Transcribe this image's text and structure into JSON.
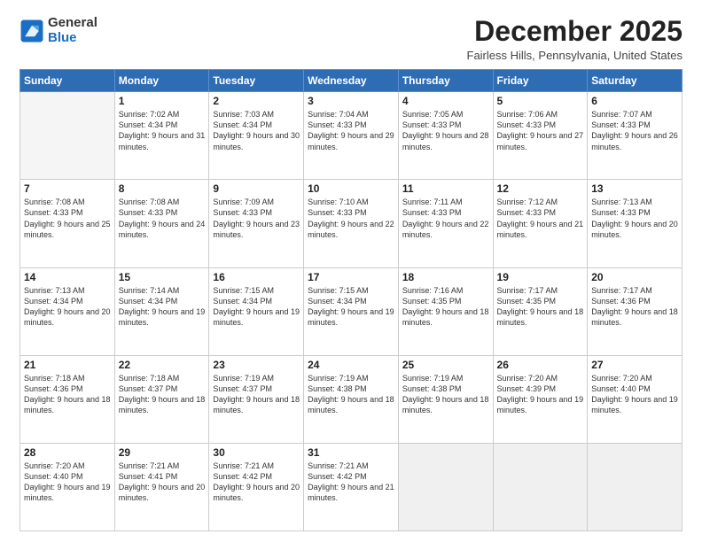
{
  "logo": {
    "general": "General",
    "blue": "Blue"
  },
  "title": "December 2025",
  "location": "Fairless Hills, Pennsylvania, United States",
  "days_of_week": [
    "Sunday",
    "Monday",
    "Tuesday",
    "Wednesday",
    "Thursday",
    "Friday",
    "Saturday"
  ],
  "weeks": [
    [
      {
        "day": "",
        "empty": true
      },
      {
        "day": "1",
        "sunrise": "7:02 AM",
        "sunset": "4:34 PM",
        "daylight": "9 hours and 31 minutes."
      },
      {
        "day": "2",
        "sunrise": "7:03 AM",
        "sunset": "4:34 PM",
        "daylight": "9 hours and 30 minutes."
      },
      {
        "day": "3",
        "sunrise": "7:04 AM",
        "sunset": "4:33 PM",
        "daylight": "9 hours and 29 minutes."
      },
      {
        "day": "4",
        "sunrise": "7:05 AM",
        "sunset": "4:33 PM",
        "daylight": "9 hours and 28 minutes."
      },
      {
        "day": "5",
        "sunrise": "7:06 AM",
        "sunset": "4:33 PM",
        "daylight": "9 hours and 27 minutes."
      },
      {
        "day": "6",
        "sunrise": "7:07 AM",
        "sunset": "4:33 PM",
        "daylight": "9 hours and 26 minutes."
      }
    ],
    [
      {
        "day": "7",
        "sunrise": "7:08 AM",
        "sunset": "4:33 PM",
        "daylight": "9 hours and 25 minutes."
      },
      {
        "day": "8",
        "sunrise": "7:08 AM",
        "sunset": "4:33 PM",
        "daylight": "9 hours and 24 minutes."
      },
      {
        "day": "9",
        "sunrise": "7:09 AM",
        "sunset": "4:33 PM",
        "daylight": "9 hours and 23 minutes."
      },
      {
        "day": "10",
        "sunrise": "7:10 AM",
        "sunset": "4:33 PM",
        "daylight": "9 hours and 22 minutes."
      },
      {
        "day": "11",
        "sunrise": "7:11 AM",
        "sunset": "4:33 PM",
        "daylight": "9 hours and 22 minutes."
      },
      {
        "day": "12",
        "sunrise": "7:12 AM",
        "sunset": "4:33 PM",
        "daylight": "9 hours and 21 minutes."
      },
      {
        "day": "13",
        "sunrise": "7:13 AM",
        "sunset": "4:33 PM",
        "daylight": "9 hours and 20 minutes."
      }
    ],
    [
      {
        "day": "14",
        "sunrise": "7:13 AM",
        "sunset": "4:34 PM",
        "daylight": "9 hours and 20 minutes."
      },
      {
        "day": "15",
        "sunrise": "7:14 AM",
        "sunset": "4:34 PM",
        "daylight": "9 hours and 19 minutes."
      },
      {
        "day": "16",
        "sunrise": "7:15 AM",
        "sunset": "4:34 PM",
        "daylight": "9 hours and 19 minutes."
      },
      {
        "day": "17",
        "sunrise": "7:15 AM",
        "sunset": "4:34 PM",
        "daylight": "9 hours and 19 minutes."
      },
      {
        "day": "18",
        "sunrise": "7:16 AM",
        "sunset": "4:35 PM",
        "daylight": "9 hours and 18 minutes."
      },
      {
        "day": "19",
        "sunrise": "7:17 AM",
        "sunset": "4:35 PM",
        "daylight": "9 hours and 18 minutes."
      },
      {
        "day": "20",
        "sunrise": "7:17 AM",
        "sunset": "4:36 PM",
        "daylight": "9 hours and 18 minutes."
      }
    ],
    [
      {
        "day": "21",
        "sunrise": "7:18 AM",
        "sunset": "4:36 PM",
        "daylight": "9 hours and 18 minutes."
      },
      {
        "day": "22",
        "sunrise": "7:18 AM",
        "sunset": "4:37 PM",
        "daylight": "9 hours and 18 minutes."
      },
      {
        "day": "23",
        "sunrise": "7:19 AM",
        "sunset": "4:37 PM",
        "daylight": "9 hours and 18 minutes."
      },
      {
        "day": "24",
        "sunrise": "7:19 AM",
        "sunset": "4:38 PM",
        "daylight": "9 hours and 18 minutes."
      },
      {
        "day": "25",
        "sunrise": "7:19 AM",
        "sunset": "4:38 PM",
        "daylight": "9 hours and 18 minutes."
      },
      {
        "day": "26",
        "sunrise": "7:20 AM",
        "sunset": "4:39 PM",
        "daylight": "9 hours and 19 minutes."
      },
      {
        "day": "27",
        "sunrise": "7:20 AM",
        "sunset": "4:40 PM",
        "daylight": "9 hours and 19 minutes."
      }
    ],
    [
      {
        "day": "28",
        "sunrise": "7:20 AM",
        "sunset": "4:40 PM",
        "daylight": "9 hours and 19 minutes."
      },
      {
        "day": "29",
        "sunrise": "7:21 AM",
        "sunset": "4:41 PM",
        "daylight": "9 hours and 20 minutes."
      },
      {
        "day": "30",
        "sunrise": "7:21 AM",
        "sunset": "4:42 PM",
        "daylight": "9 hours and 20 minutes."
      },
      {
        "day": "31",
        "sunrise": "7:21 AM",
        "sunset": "4:42 PM",
        "daylight": "9 hours and 21 minutes."
      },
      {
        "day": "",
        "empty": true
      },
      {
        "day": "",
        "empty": true
      },
      {
        "day": "",
        "empty": true
      }
    ]
  ],
  "labels": {
    "sunrise": "Sunrise:",
    "sunset": "Sunset:",
    "daylight": "Daylight:"
  }
}
